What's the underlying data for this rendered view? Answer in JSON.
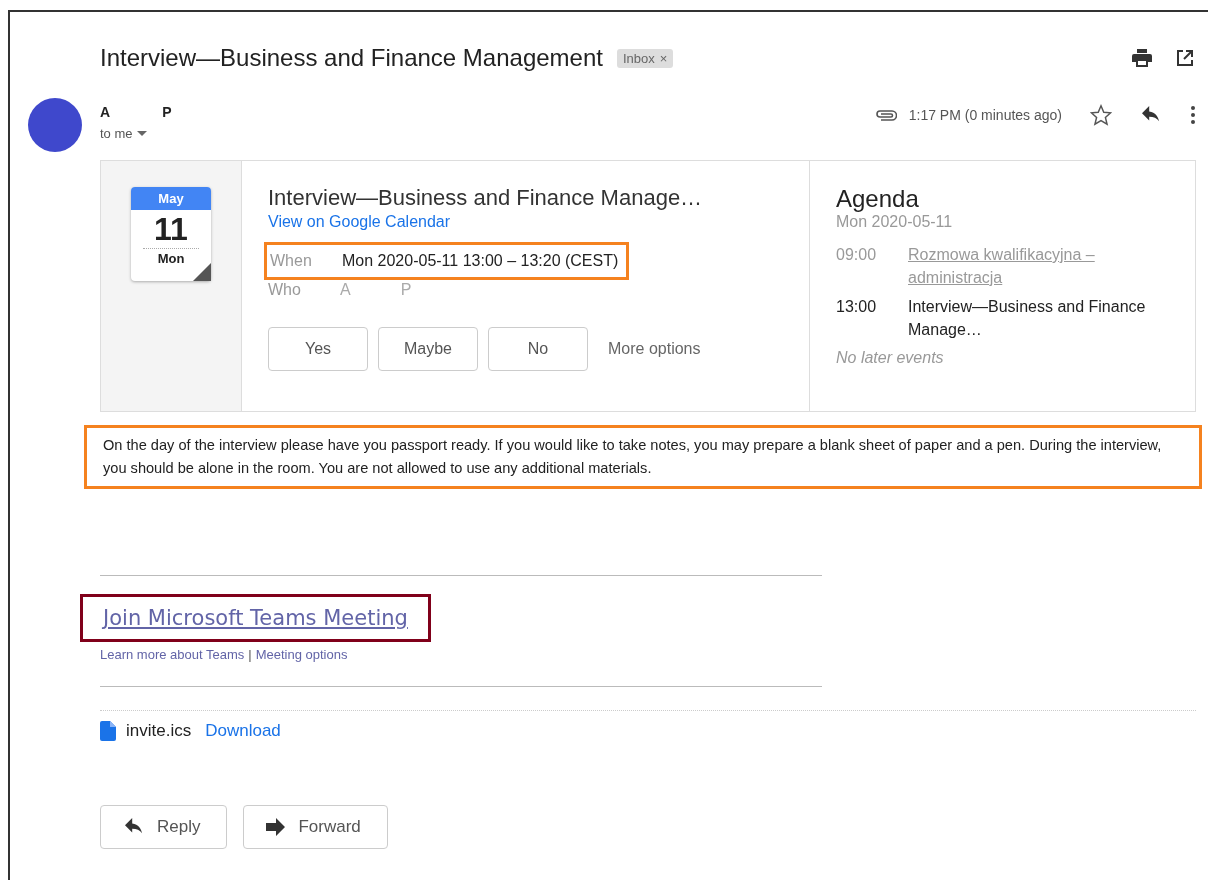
{
  "subject": "Interview—Business and Finance Management",
  "label": {
    "text": "Inbox",
    "close": "×"
  },
  "sender": {
    "first": "A",
    "last": "P",
    "to": "to me"
  },
  "time": "1:17 PM (0 minutes ago)",
  "starred": false,
  "invite": {
    "month": "May",
    "day": "11",
    "weekday": "Mon",
    "title": "Interview—Business and Finance Manage…",
    "calendar_link": "View on Google Calendar",
    "when": {
      "label": "When",
      "value": "Mon 2020-05-11 13:00 – 13:20 (CEST)",
      "color": "#f5821f"
    },
    "who": {
      "label": "Who",
      "first": "A",
      "last": "P"
    },
    "rsvp": [
      {
        "label": "Yes",
        "selected": false
      },
      {
        "label": "Maybe",
        "selected": false
      },
      {
        "label": "No",
        "selected": false
      }
    ],
    "more_options": "More options"
  },
  "agenda": {
    "title": "Agenda",
    "date": "Mon 2020-05-11",
    "events": [
      {
        "time": "09:00",
        "title": "Rozmowa kwalifikacyjna – administracja",
        "kind": "other"
      },
      {
        "time": "13:00",
        "title": "Interview—Business and Finance Manage…",
        "kind": "current"
      }
    ],
    "footer": "No later events"
  },
  "body": {
    "text": "On the day of the interview please have you passport ready. If you would like to take notes, you may prepare a blank sheet of paper and a pen. During the interview, you should be alone in the room. You are not allowed to use any additional materials.",
    "color": "#f5821f"
  },
  "teams": {
    "join": "Join Microsoft Teams Meeting",
    "color": "#80001a",
    "learn": "Learn more about Teams",
    "separator": "|",
    "options": "Meeting options"
  },
  "attachment": {
    "name": "invite.ics",
    "action": "Download"
  },
  "actions": [
    {
      "label": "Reply",
      "kind": "reply"
    },
    {
      "label": "Forward",
      "kind": "forward"
    }
  ]
}
